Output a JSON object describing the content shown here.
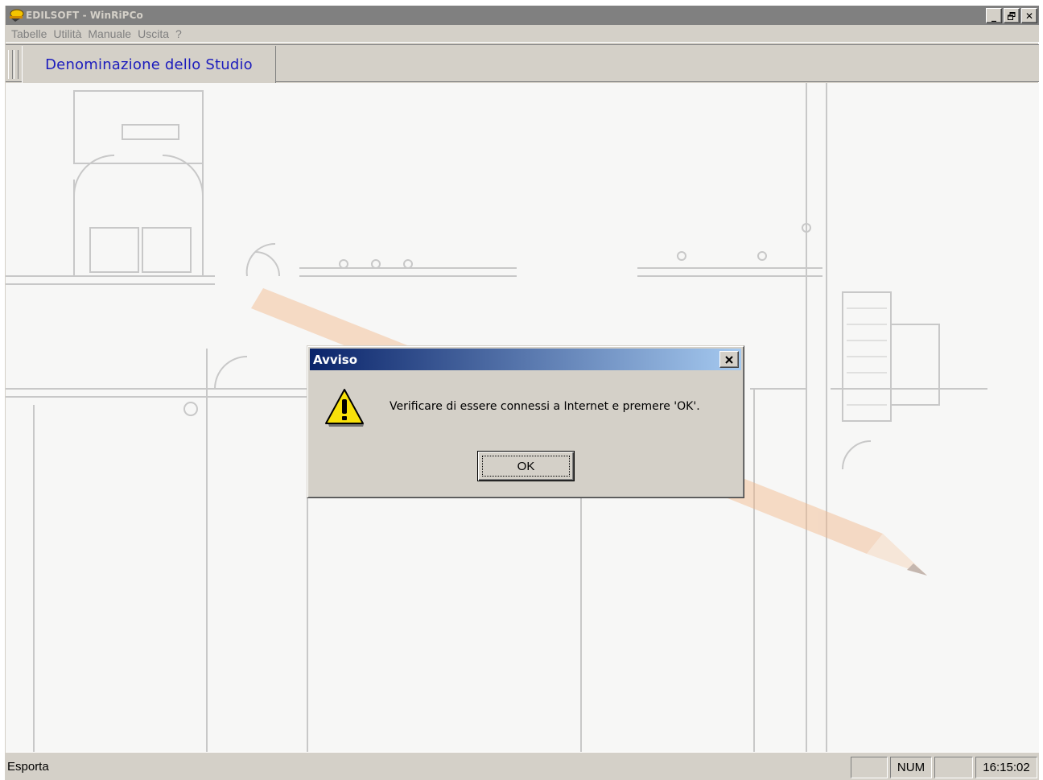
{
  "window": {
    "title": "EDILSOFT - WinRiPCo",
    "minimize_label": "_",
    "restore_label": "Ɖ",
    "close_label": "✕"
  },
  "menubar": {
    "items": [
      "Tabelle",
      "Utilità",
      "Manuale",
      "Uscita",
      "?"
    ]
  },
  "toolbar": {
    "studio_label": "Denominazione dello Studio"
  },
  "dialog": {
    "title": "Avviso",
    "close_label": "✕",
    "message": "Verificare di essere connessi a Internet e premere 'OK'.",
    "ok_label": "OK",
    "icon": "warning-icon"
  },
  "statusbar": {
    "text": "Esporta",
    "num_label": "NUM",
    "time": "16:15:02"
  },
  "colors": {
    "dialog_title_start": "#0a246a",
    "dialog_title_end": "#a6caf0",
    "studio_label": "#1c1cbd",
    "frame": "#d4d0c8"
  }
}
